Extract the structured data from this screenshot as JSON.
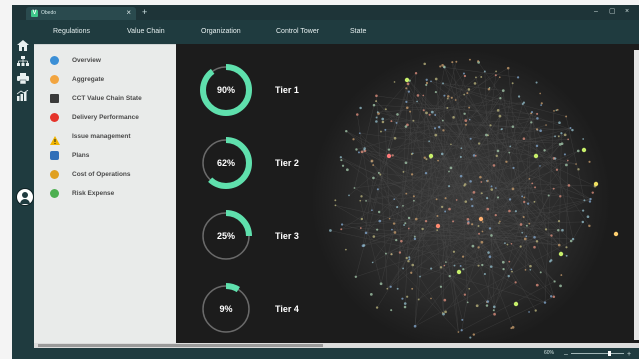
{
  "app": {
    "tab_title": "Obedo",
    "tab_close": "×",
    "new_tab": "+",
    "window_controls": [
      "–",
      "▢",
      "×"
    ]
  },
  "left_nav_icons": [
    "home-icon",
    "org-chart-icon",
    "print-icon",
    "analytics-icon"
  ],
  "top_nav": {
    "items": [
      "Regulations",
      "Value Chain",
      "Organization",
      "Control Tower",
      "State"
    ]
  },
  "menu": {
    "items": [
      {
        "label": "Overview",
        "icon": "overview-icon",
        "color": "#3b8fd6"
      },
      {
        "label": "Aggregate",
        "icon": "aggregate-icon",
        "color": "#f2a540"
      },
      {
        "label": "CCT Value Chain State",
        "icon": "value-chain-icon",
        "color": "#3a3a3a"
      },
      {
        "label": "Delivery Performance",
        "icon": "delivery-icon",
        "color": "#e5332a"
      },
      {
        "label": "Issue management",
        "icon": "warning-icon",
        "color": "#f0b400"
      },
      {
        "label": "Plans",
        "icon": "plans-icon",
        "color": "#2f6fb8"
      },
      {
        "label": "Cost of Operations",
        "icon": "cost-icon",
        "color": "#e0a020"
      },
      {
        "label": "Risk Expense",
        "icon": "risk-icon",
        "color": "#4caf50"
      }
    ]
  },
  "tiers": [
    {
      "name": "Tier 1",
      "percent_label": "90%",
      "value": 0.9
    },
    {
      "name": "Tier 2",
      "percent_label": "62%",
      "value": 0.62
    },
    {
      "name": "Tier 3",
      "percent_label": "25%",
      "value": 0.25
    },
    {
      "name": "Tier 4",
      "percent_label": "9%",
      "value": 0.09
    }
  ],
  "colors": {
    "accent": "#5fe0ad",
    "sidebar": "#1f3b3f",
    "main_bg": "#1c1c1c",
    "ring_track": "#6a6a6a"
  },
  "status": {
    "zoom": "60%"
  }
}
